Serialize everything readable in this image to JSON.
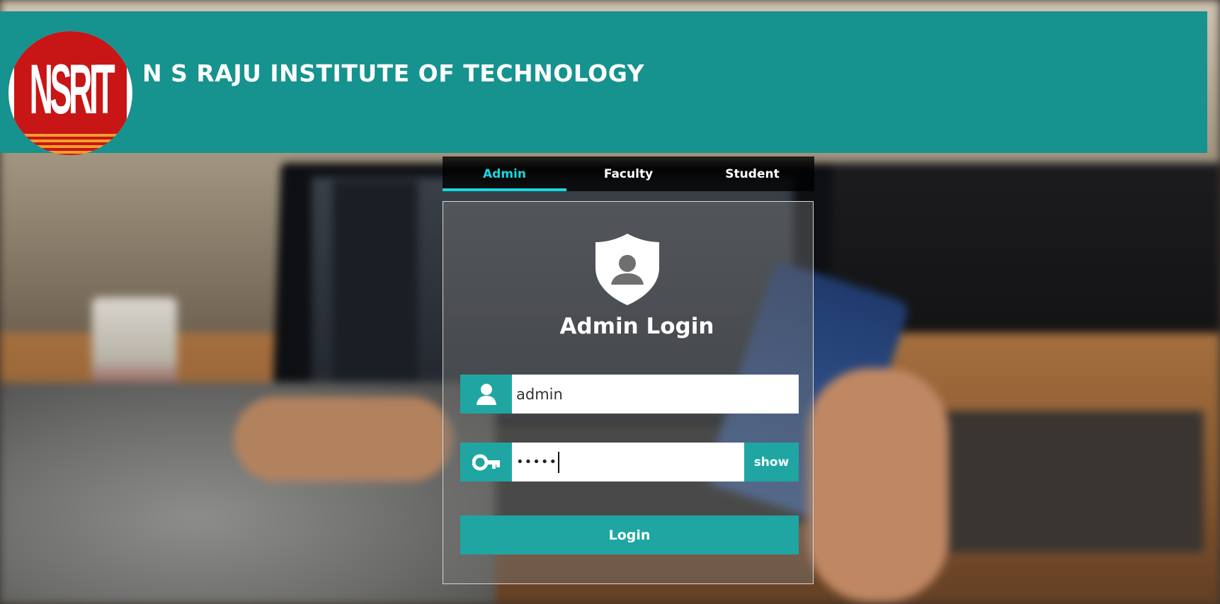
{
  "header": {
    "logo_text": "NSRIT",
    "institute_name": "N S RAJU INSTITUTE OF TECHNOLOGY"
  },
  "tabs": [
    {
      "label": "Admin",
      "active": true
    },
    {
      "label": "Faculty",
      "active": false
    },
    {
      "label": "Student",
      "active": false
    }
  ],
  "login": {
    "title": "Admin Login",
    "username_value": "admin",
    "password_masked": "•••••",
    "show_label": "show",
    "submit_label": "Login"
  },
  "icons": {
    "shield": "shield-user-icon",
    "user": "user-icon",
    "key": "key-icon"
  },
  "colors": {
    "brand_teal": "#16928f",
    "button_teal": "#1fa6a3",
    "active_tab": "#19d7e0",
    "logo_red": "#c81515"
  }
}
